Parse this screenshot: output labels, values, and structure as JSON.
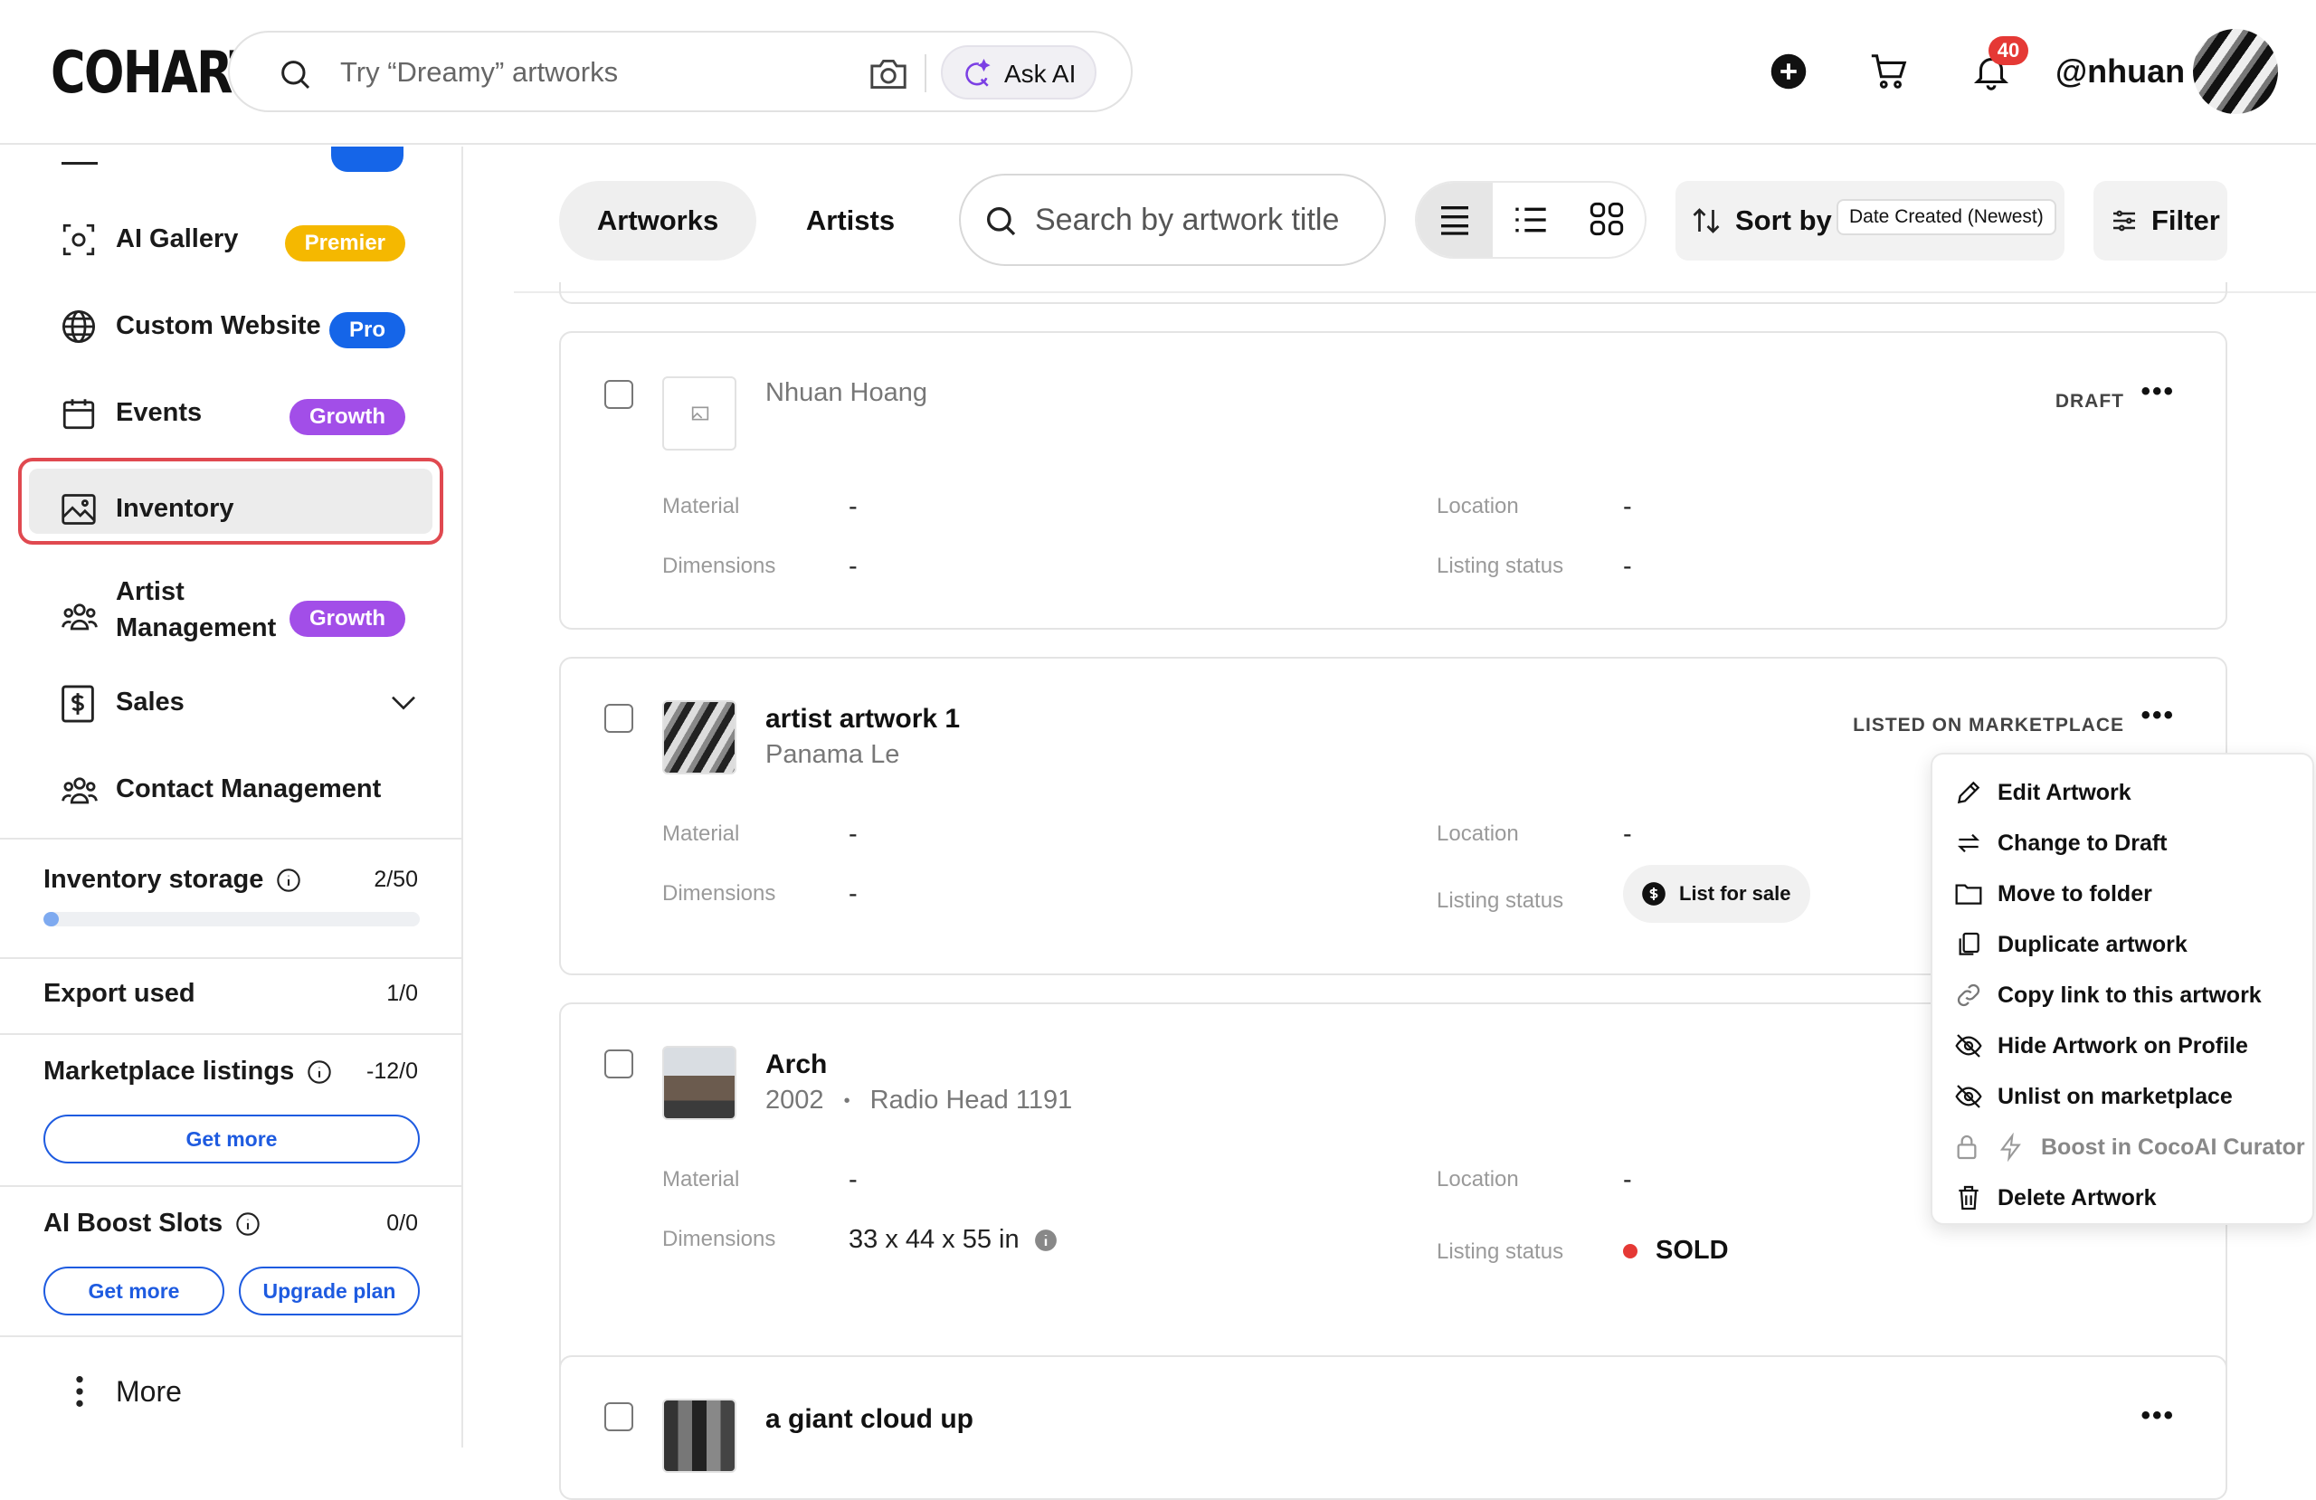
{
  "header": {
    "logo": "COHART",
    "search_placeholder": "Try “Dreamy” artworks",
    "ask_ai": "Ask AI",
    "notification_count": "40",
    "username": "@nhuan"
  },
  "sidebar": {
    "items": [
      {
        "label": "AI Gallery",
        "badge": "Premier",
        "badge_color": "#f5b800"
      },
      {
        "label": "Custom Website",
        "badge": "Pro",
        "badge_color": "#1565e8"
      },
      {
        "label": "Events",
        "badge": "Growth",
        "badge_color": "#a24ee8"
      },
      {
        "label": "Inventory"
      },
      {
        "label": "Artist Management",
        "badge": "Growth",
        "badge_color": "#a24ee8"
      },
      {
        "label": "Sales"
      },
      {
        "label": "Contact Management"
      }
    ],
    "stats": {
      "inventory_storage": {
        "label": "Inventory storage",
        "value": "2/50",
        "progress": 0.04
      },
      "export_used": {
        "label": "Export used",
        "value": "1/0"
      },
      "marketplace_listings": {
        "label": "Marketplace listings",
        "value": "-12/0",
        "button": "Get more"
      },
      "ai_boost_slots": {
        "label": "AI Boost Slots",
        "value": "0/0",
        "button_get_more": "Get more",
        "button_upgrade": "Upgrade plan"
      }
    },
    "more": "More"
  },
  "toolbar": {
    "tabs": [
      "Artworks",
      "Artists"
    ],
    "search_placeholder": "Search by artwork title",
    "sort_label": "Sort by",
    "sort_value": "Date Created (Newest)",
    "filter_label": "Filter"
  },
  "cards": [
    {
      "subtitle": "Nhuan Hoang",
      "status": "DRAFT",
      "material_label": "Material",
      "material": "-",
      "dimensions_label": "Dimensions",
      "dimensions": "-",
      "location_label": "Location",
      "location": "-",
      "listing_label": "Listing status",
      "listing": "-"
    },
    {
      "title": "artist artwork 1",
      "subtitle": "Panama Le",
      "status": "LISTED ON MARKETPLACE",
      "material_label": "Material",
      "material": "-",
      "dimensions_label": "Dimensions",
      "dimensions": "-",
      "location_label": "Location",
      "location": "-",
      "listing_label": "Listing status",
      "listing": "List for sale"
    },
    {
      "title": "Arch",
      "year": "2002",
      "bullet": "•",
      "artist": "Radio Head 1191",
      "material_label": "Material",
      "material": "-",
      "dimensions_label": "Dimensions",
      "dimensions": "33 x 44 x 55 in",
      "location_label": "Location",
      "location": "-",
      "listing_label": "Listing status",
      "listing": "SOLD"
    },
    {
      "title": "a giant cloud up"
    }
  ],
  "context_menu": [
    "Edit Artwork",
    "Change to Draft",
    "Move to folder",
    "Duplicate artwork",
    "Copy link to this artwork",
    "Hide Artwork on Profile",
    "Unlist on marketplace",
    "Boost in CocoAI Curator",
    "Delete Artwork"
  ]
}
